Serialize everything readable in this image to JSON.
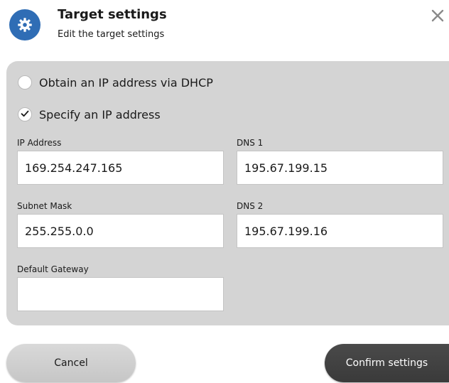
{
  "header": {
    "title": "Target settings",
    "subtitle": "Edit the target settings",
    "icon": "gear-icon",
    "close_icon": "close-icon",
    "accent_color": "#2f6db5"
  },
  "ip_mode": {
    "options": [
      {
        "label": "Obtain an IP address via DHCP",
        "selected": false
      },
      {
        "label": "Specify an IP address",
        "selected": true
      }
    ]
  },
  "fields": {
    "ip_address": {
      "label": "IP Address",
      "value": "169.254.247.165"
    },
    "subnet_mask": {
      "label": "Subnet Mask",
      "value": "255.255.0.0"
    },
    "default_gateway": {
      "label": "Default Gateway",
      "value": ""
    },
    "dns1": {
      "label": "DNS 1",
      "value": "195.67.199.15"
    },
    "dns2": {
      "label": "DNS 2",
      "value": "195.67.199.16"
    }
  },
  "buttons": {
    "cancel_label": "Cancel",
    "confirm_label": "Confirm settings"
  }
}
